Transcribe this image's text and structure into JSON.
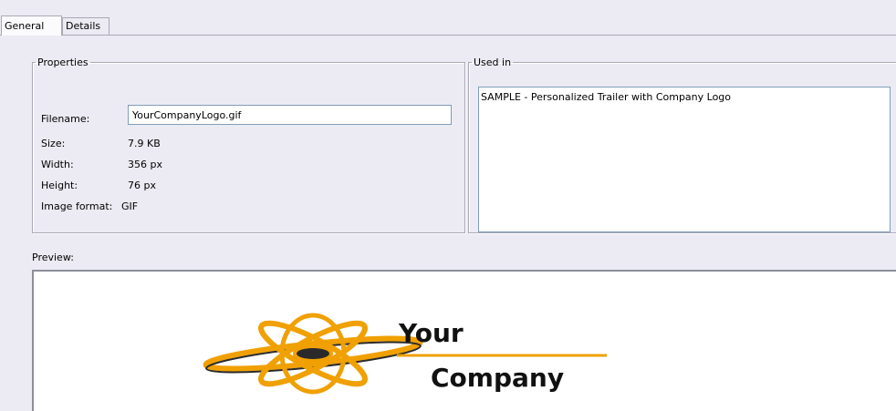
{
  "tabs": [
    {
      "label": "General",
      "active": true
    },
    {
      "label": "Details",
      "active": false
    }
  ],
  "properties": {
    "legend": "Properties",
    "filename_label": "Filename:",
    "filename_value": "YourCompanyLogo.gif",
    "size_label": "Size:",
    "size_value": "7.9 KB",
    "width_label": "Width:",
    "width_value": "356 px",
    "height_label": "Height:",
    "height_value": "76 px",
    "format_label": "Image format:",
    "format_value": "GIF"
  },
  "used_in": {
    "legend": "Used in",
    "items": [
      "SAMPLE - Personalized Trailer with Company Logo"
    ]
  },
  "preview": {
    "label": "Preview:",
    "logo_line1": "Your",
    "logo_line2": "Company",
    "colors": {
      "orange": "#f0a000",
      "dark": "#2a2a2a"
    }
  }
}
